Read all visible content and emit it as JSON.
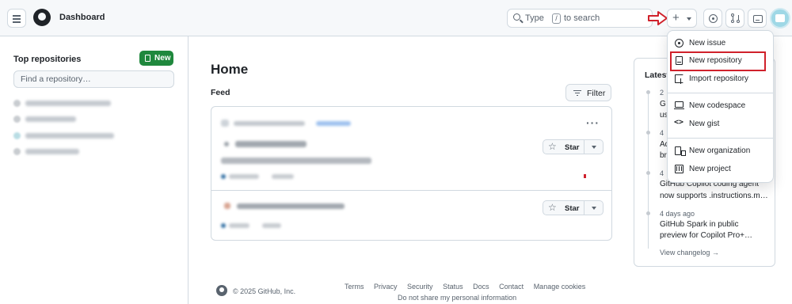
{
  "header": {
    "title": "Dashboard",
    "search": {
      "prefix": "Type",
      "key": "/",
      "suffix": "to search"
    },
    "create_plus": "+"
  },
  "sidebar": {
    "heading": "Top repositories",
    "new_button": "New",
    "find_placeholder": "Find a repository…"
  },
  "main": {
    "title": "Home",
    "feed_label": "Feed",
    "filter_button": "Filter",
    "more_menu": "···",
    "star_label": "Star"
  },
  "dropdown": {
    "items": [
      {
        "label": "New issue",
        "icon": "issue-opened-icon"
      },
      {
        "label": "New repository",
        "icon": "repo-icon"
      },
      {
        "label": "Import repository",
        "icon": "repo-push-icon"
      },
      {
        "label": "New codespace",
        "icon": "codespaces-icon"
      },
      {
        "label": "New gist",
        "icon": "code-icon"
      },
      {
        "label": "New organization",
        "icon": "organization-icon"
      },
      {
        "label": "New project",
        "icon": "project-icon"
      }
    ]
  },
  "latest": {
    "title_partial": "Latest",
    "entries": [
      {
        "date": "2",
        "text_lines": [
          "G",
          "us"
        ]
      },
      {
        "date": "4",
        "text_lines": [
          "Ad",
          "br"
        ]
      },
      {
        "date": "4",
        "text_lines": [
          "GitHub Copilot coding agent",
          "now supports .instructions.m…"
        ]
      },
      {
        "date": "4 days ago",
        "text_lines": [
          "GitHub Spark in public",
          "preview for Copilot Pro+…"
        ]
      }
    ],
    "view_changelog": "View changelog →"
  },
  "footer": {
    "copyright": "© 2025 GitHub, Inc.",
    "links": [
      "Terms",
      "Privacy",
      "Security",
      "Status",
      "Docs",
      "Contact",
      "Manage cookies"
    ],
    "privacy_line": "Do not share my personal information"
  },
  "colors": {
    "primary_green": "#1f883d",
    "highlight_red": "#d0212b",
    "border": "#d1d9e0",
    "header_bg": "#f6f8fa"
  }
}
